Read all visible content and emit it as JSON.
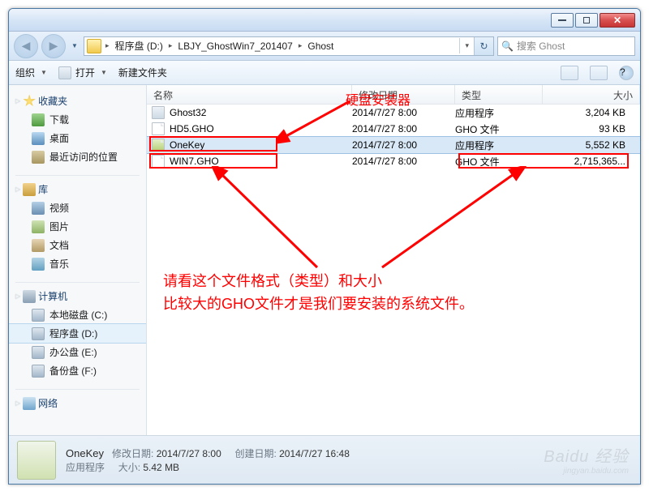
{
  "window": {
    "title": ""
  },
  "breadcrumb": {
    "items": [
      "程序盘 (D:)",
      "LBJY_GhostWin7_201407",
      "Ghost"
    ]
  },
  "search": {
    "placeholder": "搜索 Ghost"
  },
  "toolbar": {
    "organize": "组织",
    "open": "打开",
    "newfolder": "新建文件夹"
  },
  "sidebar": {
    "favorites": "收藏夹",
    "fav_items": [
      "下载",
      "桌面",
      "最近访问的位置"
    ],
    "libraries": "库",
    "lib_items": [
      "视频",
      "图片",
      "文档",
      "音乐"
    ],
    "computer": "计算机",
    "drives": [
      "本地磁盘 (C:)",
      "程序盘 (D:)",
      "办公盘 (E:)",
      "备份盘 (F:)"
    ],
    "network": "网络"
  },
  "columns": {
    "name": "名称",
    "date": "修改日期",
    "type": "类型",
    "size": "大小"
  },
  "files": [
    {
      "name": "Ghost32",
      "date": "2014/7/27 8:00",
      "type": "应用程序",
      "size": "3,204 KB"
    },
    {
      "name": "HD5.GHO",
      "date": "2014/7/27 8:00",
      "type": "GHO 文件",
      "size": "93 KB"
    },
    {
      "name": "OneKey",
      "date": "2014/7/27 8:00",
      "type": "应用程序",
      "size": "5,552 KB"
    },
    {
      "name": "WIN7.GHO",
      "date": "2014/7/27 8:00",
      "type": "GHO 文件",
      "size": "2,715,365..."
    }
  ],
  "annotation": {
    "label1": "硬盘安装器",
    "para_line1": "请看这个文件格式（类型）和大小",
    "para_line2": "比较大的GHO文件才是我们要安装的系统文件。"
  },
  "details": {
    "filename": "OneKey",
    "mod_label": "修改日期:",
    "mod_value": "2014/7/27 8:00",
    "type_value": "应用程序",
    "create_label": "创建日期:",
    "create_value": "2014/7/27 16:48",
    "size_label": "大小:",
    "size_value": "5.42 MB"
  },
  "watermark": {
    "brand": "Baidu 经验",
    "url": "jingyan.baidu.com"
  }
}
